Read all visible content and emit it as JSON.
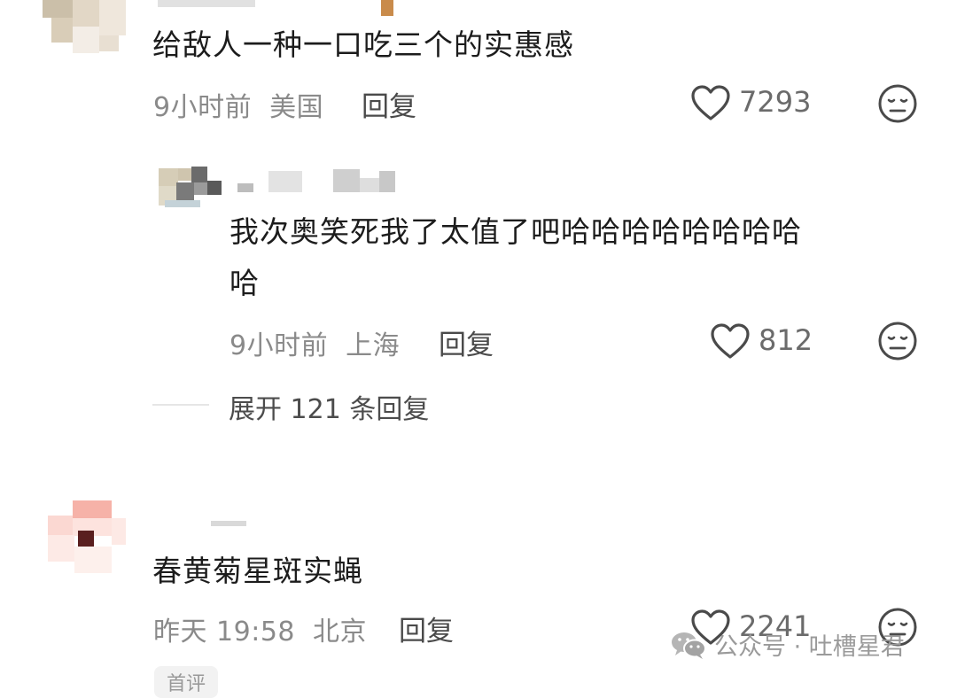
{
  "comments": [
    {
      "text": "给敌人一种一口吃三个的实惠感",
      "time": "9小时前",
      "location": "美国",
      "reply_label": "回复",
      "likes": "7293"
    },
    {
      "text_line1": "我次奥笑死我了太值了吧哈哈哈哈哈哈哈哈",
      "text_line2": "哈",
      "time": "9小时前",
      "location": "上海",
      "reply_label": "回复",
      "likes": "812"
    },
    {
      "text": "春黄菊星斑实蝇",
      "time": "昨天 19:58",
      "location": "北京",
      "reply_label": "回复",
      "likes": "2241",
      "tag": "首评"
    }
  ],
  "expand_replies": "展开 121 条回复",
  "watermark": "公众号 · 吐槽星君",
  "icons": {
    "like": "heart-outline-icon",
    "dislike": "meh-face-icon",
    "watermark": "wechat-icon"
  },
  "colors": {
    "text": "#1c1c1c",
    "meta": "#8a8a8a",
    "icon": "#4a4a4a"
  }
}
